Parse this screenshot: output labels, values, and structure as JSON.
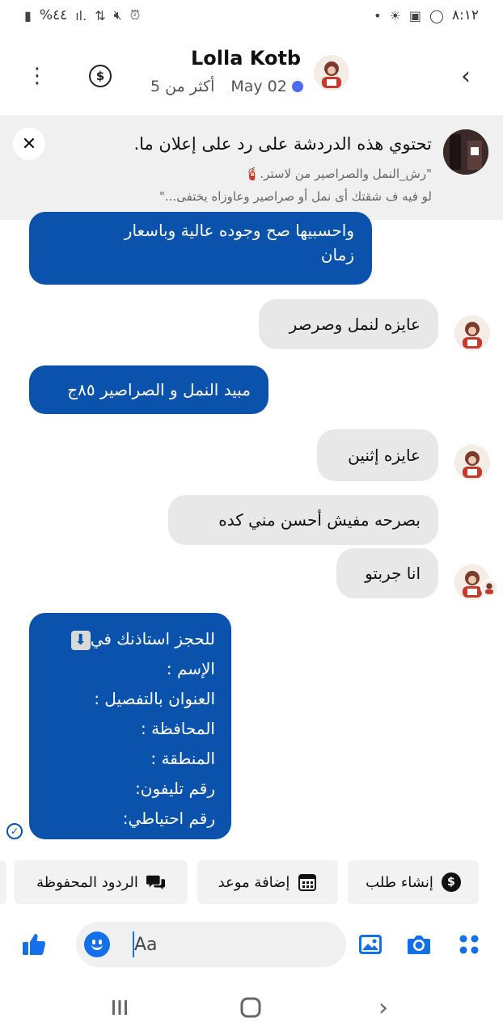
{
  "status_bar": {
    "time": "٨:١٢",
    "battery": "%٤٤"
  },
  "header": {
    "contact_name": "Lolla Kotb",
    "date": "May 02",
    "status": "أكثر من 5"
  },
  "ad_banner": {
    "title": "تحتوي هذه الدردشة على رد على إعلان ما.",
    "line1": "\"رش_النمل والصراصير من لاستر.🧯",
    "line2": "لو فيه ف شقتك أى نمل أو صراصير وعاوزاه يختفى...\""
  },
  "messages": [
    {
      "direction": "outgoing",
      "lines": [
        "واحسبيها صح وجوده عالية وباسعار",
        "زمان"
      ]
    },
    {
      "direction": "incoming",
      "text": "عايزه لنمل وصرصر"
    },
    {
      "direction": "outgoing",
      "text": "مبيد النمل و الصراصير ٨٥ج"
    },
    {
      "direction": "incoming",
      "text": "عايزه إثنين"
    },
    {
      "direction": "incoming",
      "text": "بصرحه مفيش أحسن مني كده"
    },
    {
      "direction": "incoming",
      "text": "انا جربتو"
    },
    {
      "direction": "outgoing",
      "first_line": "للحجز استاذنك في",
      "lines": [
        "الإسم :",
        "العنوان بالتفصيل :",
        "المحافظة :",
        "المنطقة :",
        "رقم تليفون:",
        "رقم احتياطي:"
      ]
    }
  ],
  "quick_actions": [
    {
      "label": "إنشاء طلب",
      "icon": "dollar-icon"
    },
    {
      "label": "إضافة موعد",
      "icon": "calendar-icon"
    },
    {
      "label": "الردود المحفوظة",
      "icon": "chat-bubbles-icon"
    }
  ],
  "composer": {
    "placeholder": "Aa"
  },
  "colors": {
    "outgoing_bubble": "#0b52ad",
    "incoming_bubble": "#e8e8e8",
    "accent": "#1470e8"
  }
}
